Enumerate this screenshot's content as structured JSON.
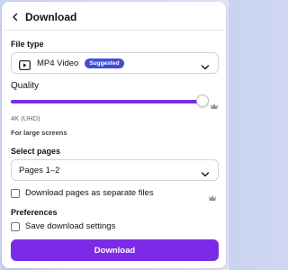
{
  "header": {
    "title": "Download"
  },
  "file_type": {
    "label": "File type",
    "selected": "MP4 Video",
    "badge": "Suggested"
  },
  "quality": {
    "label": "Quality",
    "level": 1.0,
    "value": "4K (UHD)",
    "description": "For large screens"
  },
  "select_pages": {
    "label": "Select pages",
    "selected": "Pages 1–2"
  },
  "separate_files": {
    "label": "Download pages as separate files",
    "checked": false
  },
  "preferences": {
    "label": "Preferences",
    "save_settings": {
      "label": "Save download settings",
      "checked": false
    }
  },
  "download_button": {
    "label": "Download"
  },
  "colors": {
    "accent": "#7d2ae8",
    "badge": "#3f4dd6",
    "crown": "#8e959d"
  },
  "icons": [
    "chevron-left-icon",
    "video-icon",
    "chevron-down-icon",
    "crown-icon"
  ]
}
